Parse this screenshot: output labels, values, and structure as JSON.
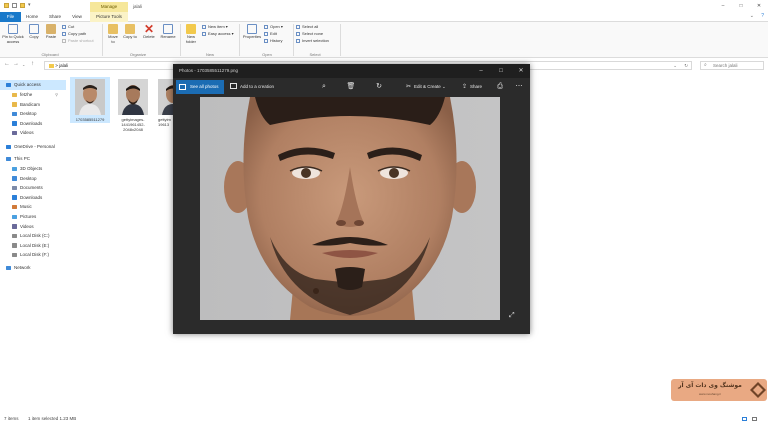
{
  "window": {
    "title": "jalali",
    "manage_label": "Manage",
    "controls": {
      "minimize": "–",
      "maximize": "□",
      "close": "✕"
    }
  },
  "tabs": [
    {
      "label": "File"
    },
    {
      "label": "Home"
    },
    {
      "label": "Share"
    },
    {
      "label": "View"
    },
    {
      "label": "Picture Tools"
    }
  ],
  "ribbon": {
    "clipboard": {
      "pin": "Pin to Quick access",
      "copy": "Copy",
      "paste": "Paste",
      "cut": "Cut",
      "copy_path": "Copy path",
      "paste_shortcut": "Paste shortcut",
      "group": "Clipboard"
    },
    "organize": {
      "move_to": "Move to",
      "copy_to": "Copy to",
      "delete": "Delete",
      "rename": "Rename",
      "group": "Organize"
    },
    "new": {
      "new_folder": "New folder",
      "new_item": "New item",
      "easy_access": "Easy access",
      "group": "New"
    },
    "open": {
      "properties": "Properties",
      "open": "Open",
      "edit": "Edit",
      "history": "History",
      "group": "Open"
    },
    "select": {
      "select_all": "Select all",
      "select_none": "Select none",
      "invert": "Invert selection",
      "group": "Select"
    }
  },
  "address": {
    "path_root": ">",
    "path": "jalali",
    "search_placeholder": "Search jalali"
  },
  "sidebar": [
    {
      "label": "Quick access",
      "icon": "star-icon",
      "color": "#2b7fd8",
      "level": 0,
      "selected": true
    },
    {
      "label": "fetzhe",
      "icon": "folder-icon",
      "color": "#e8b84a",
      "level": 1,
      "pinned": true
    },
    {
      "label": "Bandicam",
      "icon": "folder-icon",
      "color": "#e8b84a",
      "level": 1
    },
    {
      "label": "Desktop",
      "icon": "desktop-icon",
      "color": "#3f8ad8",
      "level": 1
    },
    {
      "label": "Downloads",
      "icon": "downloads-icon",
      "color": "#2b7fd8",
      "level": 1
    },
    {
      "label": "Videos",
      "icon": "videos-icon",
      "color": "#6a6a9a",
      "level": 1
    },
    {
      "label": "OneDrive - Personal",
      "icon": "onedrive-icon",
      "color": "#2b7fd8",
      "level": 0
    },
    {
      "label": "This PC",
      "icon": "pc-icon",
      "color": "#3f8ad8",
      "level": 0
    },
    {
      "label": "3D Objects",
      "icon": "3d-icon",
      "color": "#4aa0e0",
      "level": 1
    },
    {
      "label": "Desktop",
      "icon": "desktop-icon",
      "color": "#3f8ad8",
      "level": 1
    },
    {
      "label": "Documents",
      "icon": "documents-icon",
      "color": "#7c8aa8",
      "level": 1
    },
    {
      "label": "Downloads",
      "icon": "downloads-icon",
      "color": "#2b7fd8",
      "level": 1
    },
    {
      "label": "Music",
      "icon": "music-icon",
      "color": "#d07a3a",
      "level": 1
    },
    {
      "label": "Pictures",
      "icon": "pictures-icon",
      "color": "#4aa0e0",
      "level": 1
    },
    {
      "label": "Videos",
      "icon": "videos-icon",
      "color": "#6a6a9a",
      "level": 1
    },
    {
      "label": "Local Disk (C:)",
      "icon": "disk-icon",
      "color": "#8a8a8a",
      "level": 1
    },
    {
      "label": "Local Disk (E:)",
      "icon": "disk-icon",
      "color": "#8a8a8a",
      "level": 1
    },
    {
      "label": "Local Disk (F:)",
      "icon": "disk-icon",
      "color": "#8a8a8a",
      "level": 1
    },
    {
      "label": "Network",
      "icon": "network-icon",
      "color": "#3f8ad8",
      "level": 0
    }
  ],
  "files": [
    {
      "name": "1703585511279",
      "selected": true
    },
    {
      "name": "gettyimages-1441961452-2048x2048",
      "selected": false
    },
    {
      "name": "gettyim 19613",
      "selected": false
    }
  ],
  "status": {
    "items": "7 items",
    "selected": "1 item selected  1.23 MB"
  },
  "photos": {
    "title": "Photos - 1703585511279.png",
    "see_all": "See all photos",
    "add_to_creation": "Add to a creation",
    "edit_create": "Edit & Create",
    "share": "Share",
    "icons": [
      "zoom-icon",
      "delete-icon",
      "rotate-icon",
      "edit-create-icon",
      "share-icon",
      "print-icon",
      "more-icon",
      "expand-icon"
    ]
  },
  "watermark": {
    "text": "موشنگ وی دات آی آر",
    "sub": "www.moshang.ir"
  }
}
